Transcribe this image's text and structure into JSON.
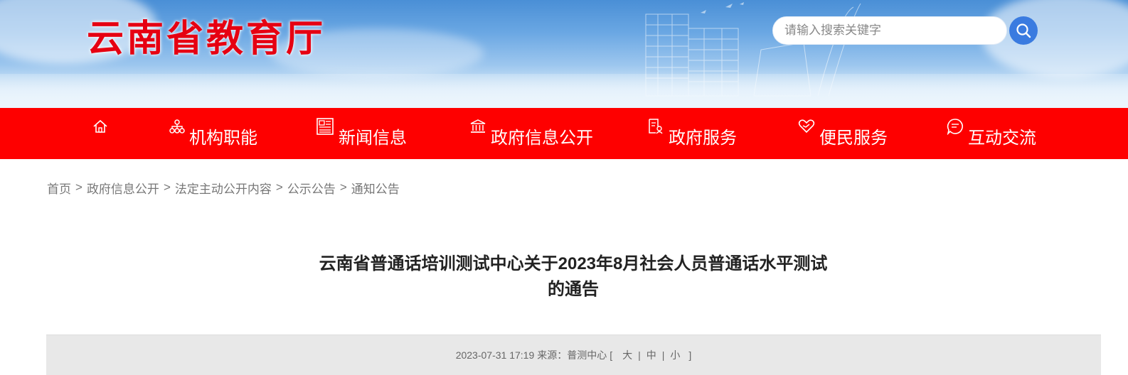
{
  "header": {
    "site_title": "云南省教育厅",
    "search_placeholder": "请输入搜索关键字",
    "search_button_icon": "search-icon"
  },
  "nav": {
    "items": [
      {
        "label": "",
        "icon": "home-icon"
      },
      {
        "label": "机构职能",
        "icon": "org-chart-icon"
      },
      {
        "label": "新闻信息",
        "icon": "newspaper-icon"
      },
      {
        "label": "政府信息公开",
        "icon": "government-building-icon"
      },
      {
        "label": "政府服务",
        "icon": "service-document-icon"
      },
      {
        "label": "便民服务",
        "icon": "heart-hand-icon"
      },
      {
        "label": "互动交流",
        "icon": "chat-bubble-icon"
      }
    ]
  },
  "breadcrumb": {
    "items": [
      "首页",
      "政府信息公开",
      "法定主动公开内容",
      "公示公告",
      "通知公告"
    ],
    "separator": ">"
  },
  "article": {
    "title_line1": "云南省普通话培训测试中心关于2023年8月社会人员普通话水平测试",
    "title_line2": "的通告",
    "meta": {
      "date": "2023-07-31 17:19",
      "source_label": "来源：",
      "source": "普测中心",
      "bracket_open": "[",
      "bracket_close": "]",
      "pipe": "|",
      "font_large": "大",
      "font_medium": "中",
      "font_small": "小"
    }
  },
  "colors": {
    "nav_bg": "#fe0000",
    "title_red": "#e60012",
    "search_button": "#3a7be0",
    "meta_bg": "#e8e8e8"
  }
}
